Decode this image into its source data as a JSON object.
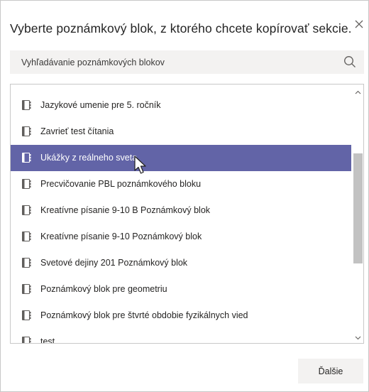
{
  "dialog": {
    "title": "Vyberte poznámkový blok, z ktorého chcete kopírovať sekcie.",
    "close_icon": "close-icon"
  },
  "search": {
    "placeholder": "Vyhľadávanie poznámkových blokov",
    "value": "",
    "icon": "search-icon"
  },
  "notebooks": {
    "selected_index": 2,
    "items": [
      {
        "label": "Jazykové umenie pre 5. ročník"
      },
      {
        "label": "Zavrieť test čítania"
      },
      {
        "label": "Ukážky z reálneho sveta"
      },
      {
        "label": "Precvičovanie PBL poznámkového bloku"
      },
      {
        "label": "Kreatívne písanie 9-10 B Poznámkový blok"
      },
      {
        "label": "Kreatívne písanie 9-10 Poznámkový blok"
      },
      {
        "label": "Svetové dejiny 201  Poznámkový blok"
      },
      {
        "label": "Poznámkový blok pre geometriu"
      },
      {
        "label": "Poznámkový blok pre štvrté obdobie fyzikálnych vied"
      },
      {
        "label": "test"
      }
    ]
  },
  "footer": {
    "next_label": "Ďalšie"
  },
  "colors": {
    "selected_bg": "#6264a7",
    "button_bg": "#f3f2f1",
    "scroll_thumb": "#c2c2c2"
  }
}
